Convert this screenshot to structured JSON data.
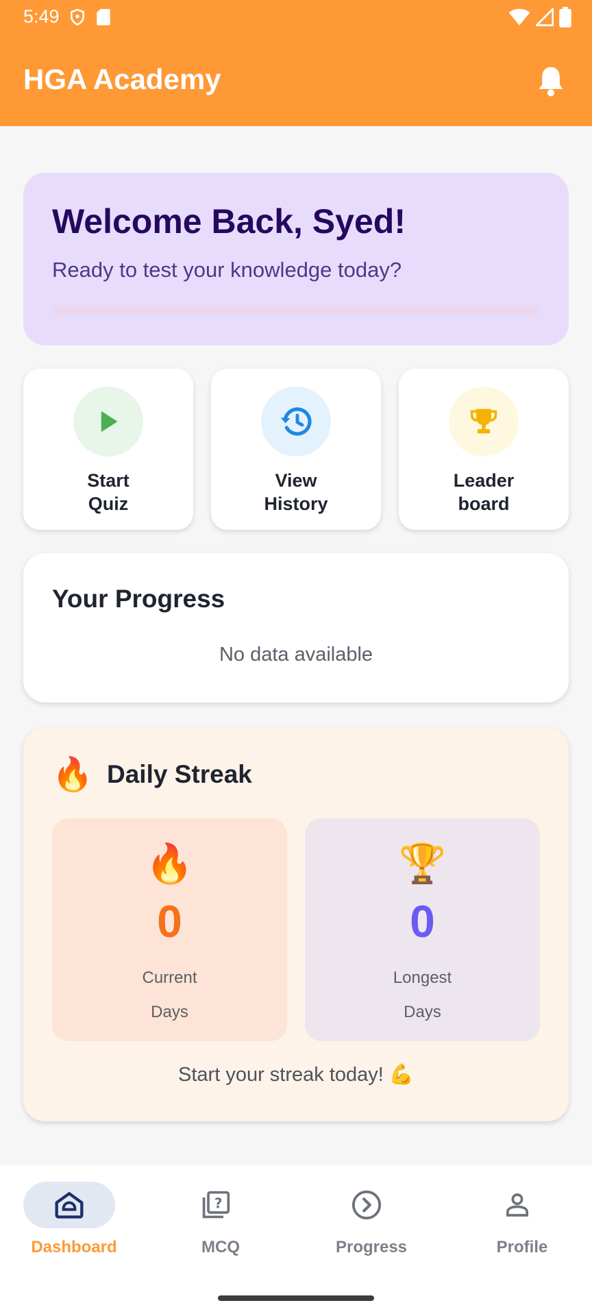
{
  "status": {
    "time": "5:49",
    "icons": [
      "shield-icon",
      "sd-card-icon",
      "wifi-icon",
      "signal-icon",
      "battery-icon"
    ]
  },
  "app": {
    "title": "HGA Academy",
    "notification_icon": "bell-icon",
    "accent_color": "#fe9936"
  },
  "welcome": {
    "title": "Welcome Back, Syed!",
    "subtitle": "Ready to test your knowledge today?",
    "progress_fraction": 0
  },
  "actions": [
    {
      "label": "Start\nQuiz",
      "icon": "play-icon",
      "color": "#4caf50",
      "bg": "#e8f5e9"
    },
    {
      "label": "View\nHistory",
      "icon": "history-icon",
      "color": "#1e88e5",
      "bg": "#e3f2fd"
    },
    {
      "label": "Leader\nboard",
      "icon": "trophy-icon",
      "color": "#f5b301",
      "bg": "#fff8e1"
    }
  ],
  "progress": {
    "title": "Your Progress",
    "empty_text": "No data available"
  },
  "streak": {
    "title": "Daily Streak",
    "title_emoji": "🔥",
    "current": {
      "emoji": "🔥",
      "value": "0",
      "label": "Current\nDays",
      "color": "#f5711a",
      "bg": "#fde4d6"
    },
    "longest": {
      "emoji": "🏆",
      "value": "0",
      "label": "Longest\nDays",
      "color": "#6a5cf0",
      "bg": "#eee6ef"
    },
    "message": "Start your streak today! 💪"
  },
  "nav": {
    "items": [
      {
        "label": "Dashboard",
        "icon": "home-icon",
        "active": true
      },
      {
        "label": "MCQ",
        "icon": "quiz-icon",
        "active": false
      },
      {
        "label": "Progress",
        "icon": "chevron-circle-icon",
        "active": false
      },
      {
        "label": "Profile",
        "icon": "person-icon",
        "active": false
      }
    ],
    "active_color": "#fe9936",
    "active_pill_color": "#e2e8f2"
  }
}
